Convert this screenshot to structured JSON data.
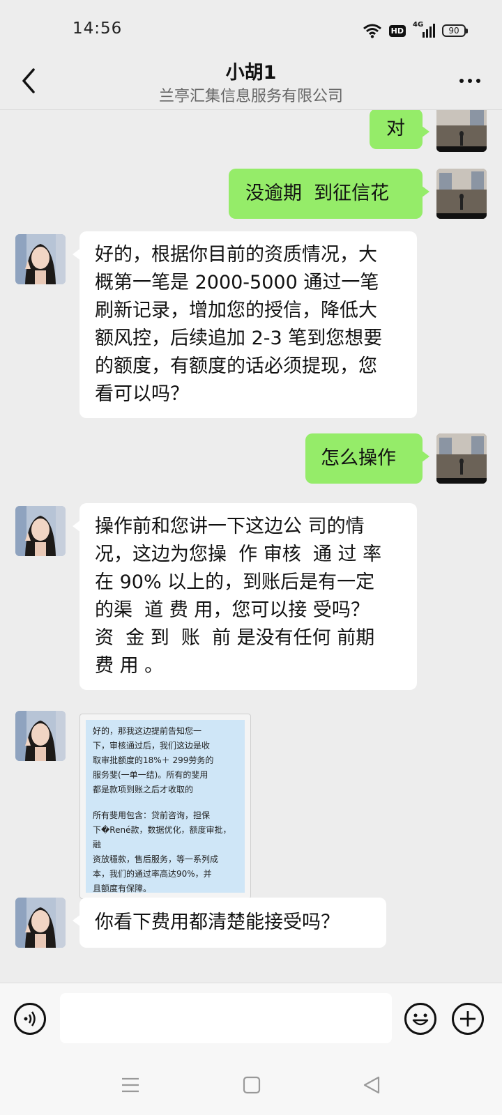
{
  "status_bar": {
    "time": "14:56",
    "hd_label": "HD",
    "network_label": "4G",
    "battery": "90"
  },
  "header": {
    "title": "小胡1",
    "subtitle": "兰亭汇集信息服务有限公司",
    "back_icon": "chevron-left-icon",
    "more_icon": "more-dots-icon"
  },
  "messages": [
    {
      "from": "me",
      "text": "对"
    },
    {
      "from": "me",
      "text": "没逾期  到征信花"
    },
    {
      "from": "them",
      "lines": [
        "好的，根据你目前的资质情况，大",
        "概第一笔是 2000-5000 通过一笔",
        "刷新记录，增加您的授信，降低大",
        "额风控，后续追加 2-3 笔到您想要",
        "的额度，有额度的话必须提现，您",
        "看可以吗？"
      ]
    },
    {
      "from": "me",
      "text": "怎么操作"
    },
    {
      "from": "them",
      "lines": [
        "操作前和您讲一下这边公 司的情",
        "况，这边为您操  作 审核  通 过 率",
        "在 90% 以上的，到账后是有一定",
        "的渠  道 费 用，您可以接 受吗？",
        "资  金 到  账  前 是没有任何 前期",
        "费 用 。"
      ]
    },
    {
      "from": "them",
      "type": "image",
      "image_text": {
        "para1": [
          "好的，那我这边提前告知您一",
          "下，审核通过后，我们这边是收",
          "取审批额度的18%＋ 299劳务的",
          "服务斐(一单一结)。所有的斐用",
          "都是款项到账之后才收取的"
        ],
        "para2": [
          "所有斐用包含：贷前咨询，担保",
          "下�René款，数据优化，额度审批，融",
          "资放穩款，售后服务，等一系列成",
          "本，我们的通过率高达90%，并",
          "且额度有保障。"
        ]
      }
    },
    {
      "from": "them",
      "text": "你看下费用都清楚能接受吗？"
    }
  ],
  "input_bar": {
    "voice_icon": "voice-icon",
    "emoji_icon": "emoji-icon",
    "add_icon": "add-icon",
    "message_value": ""
  },
  "nav_bar": {
    "menu_icon": "menu-icon",
    "home_icon": "home-square-icon",
    "back_icon": "back-triangle-icon"
  }
}
